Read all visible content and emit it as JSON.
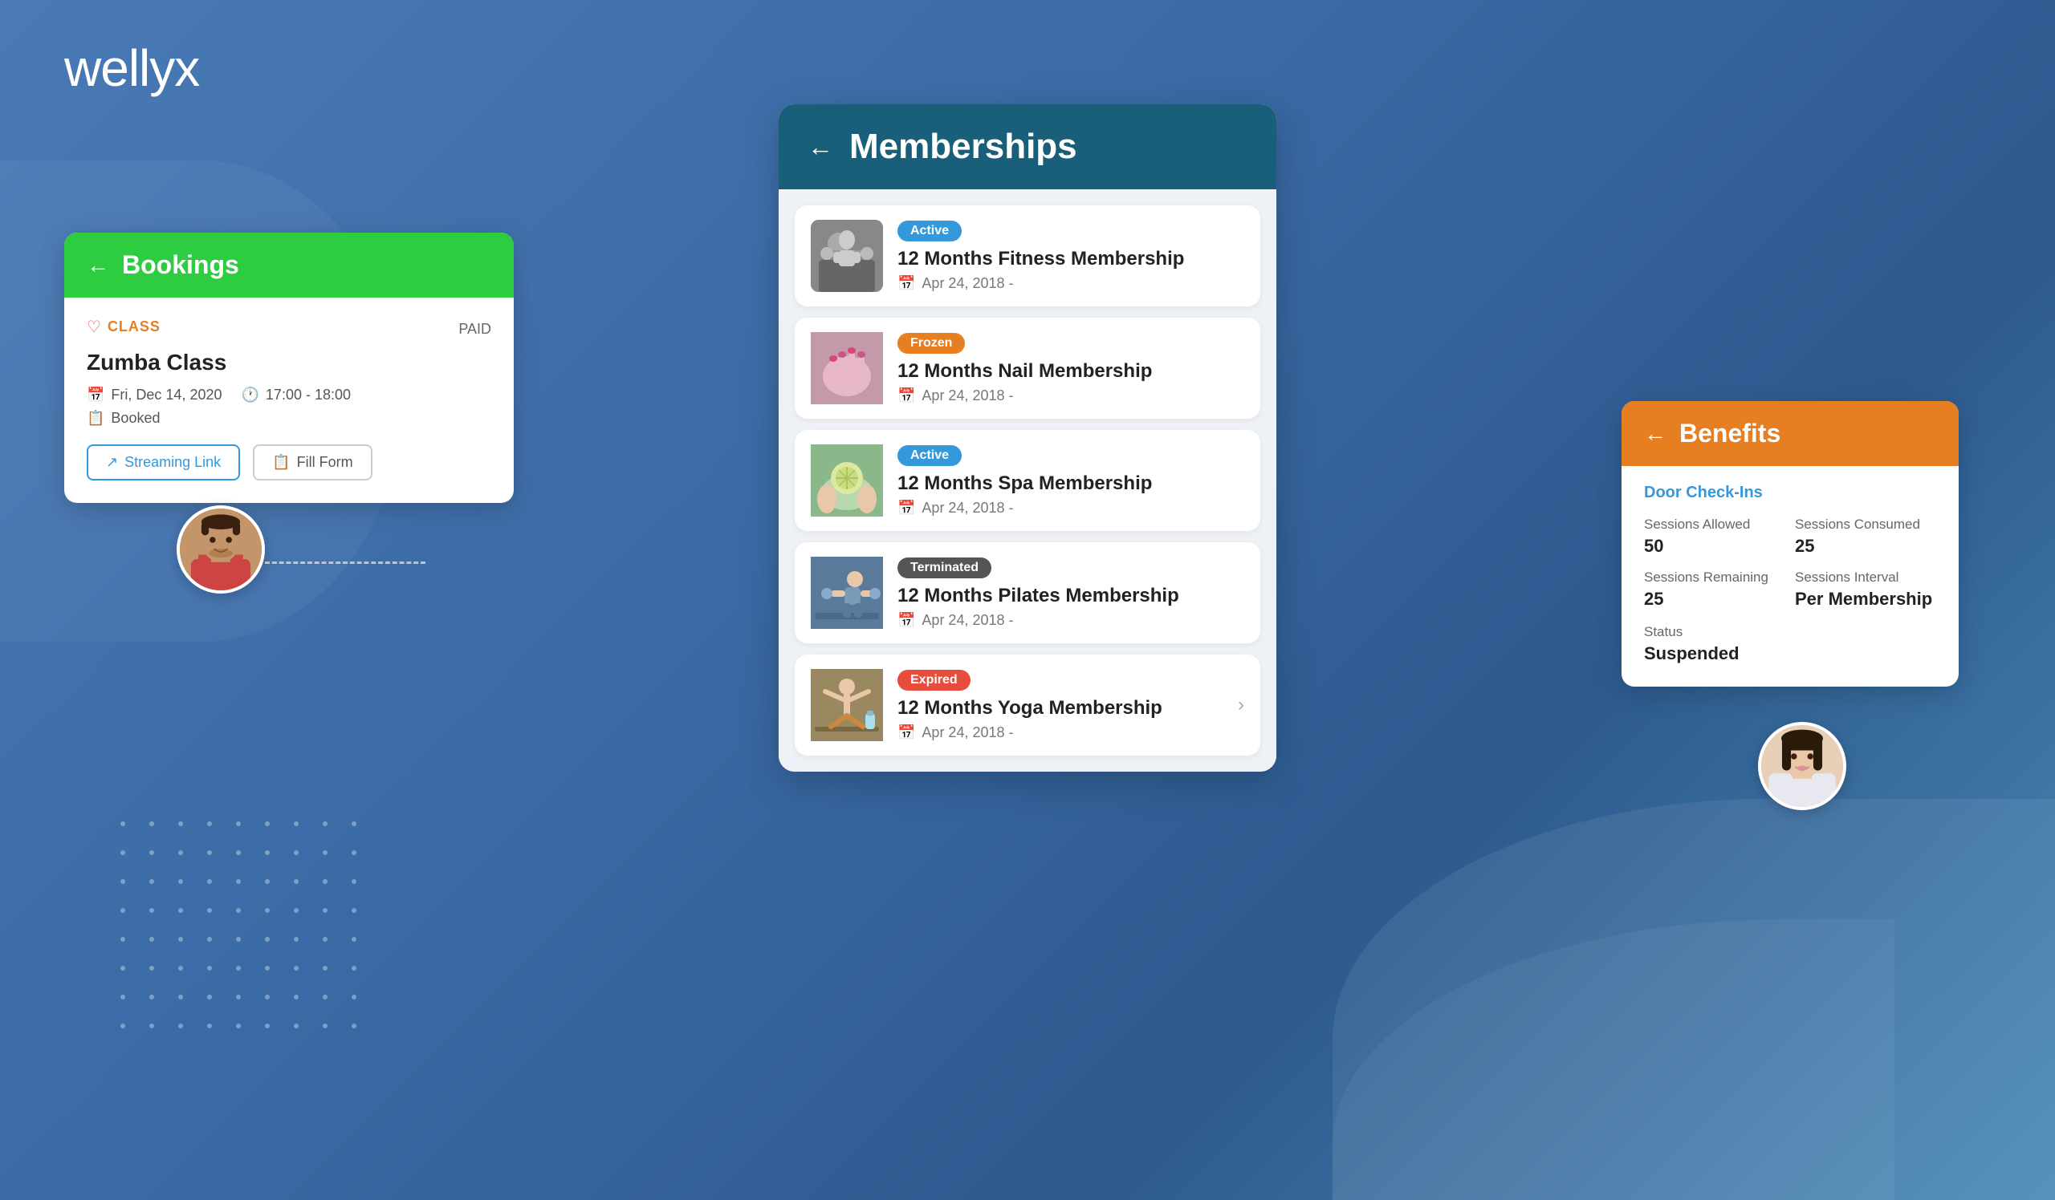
{
  "app": {
    "logo": "wellyx"
  },
  "background": {
    "color": "#4a7ab5"
  },
  "bookings": {
    "header": {
      "arrow": "←",
      "title": "Bookings"
    },
    "class_label": "CLASS",
    "paid_label": "PAID",
    "class_name": "Zumba Class",
    "date": "Fri, Dec 14, 2020",
    "time": "17:00 - 18:00",
    "status": "Booked",
    "btn_streaming": "Streaming Link",
    "btn_fill_form": "Fill Form"
  },
  "memberships": {
    "header": {
      "arrow": "←",
      "title": "Memberships"
    },
    "items": [
      {
        "badge": "Active",
        "badge_class": "badge-active",
        "name": "12 Months Fitness Membership",
        "date": "Apr 24, 2018  -",
        "img_class": "img-fitness",
        "has_chevron": false
      },
      {
        "badge": "Frozen",
        "badge_class": "badge-frozen",
        "name": "12 Months Nail Membership",
        "date": "Apr 24, 2018  -",
        "img_class": "img-nail",
        "has_chevron": false
      },
      {
        "badge": "Active",
        "badge_class": "badge-active",
        "name": "12 Months Spa Membership",
        "date": "Apr 24, 2018  -",
        "img_class": "img-spa",
        "has_chevron": false
      },
      {
        "badge": "Terminated",
        "badge_class": "badge-terminated",
        "name": "12 Months Pilates Membership",
        "date": "Apr 24, 2018  -",
        "img_class": "img-pilates",
        "has_chevron": false
      },
      {
        "badge": "Expired",
        "badge_class": "badge-expired",
        "name": "12 Months Yoga Membership",
        "date": "Apr 24, 2018  -",
        "img_class": "img-yoga",
        "has_chevron": true
      }
    ]
  },
  "benefits": {
    "header": {
      "arrow": "←",
      "title": "Benefits"
    },
    "section_title": "Door Check-Ins",
    "sessions_allowed_label": "Sessions Allowed",
    "sessions_allowed_value": "50",
    "sessions_consumed_label": "Sessions Consumed",
    "sessions_consumed_value": "25",
    "sessions_remaining_label": "Sessions Remaining",
    "sessions_remaining_value": "25",
    "sessions_interval_label": "Sessions Interval",
    "sessions_interval_value": "Per Membership",
    "status_label": "Status",
    "status_value": "Suspended"
  }
}
